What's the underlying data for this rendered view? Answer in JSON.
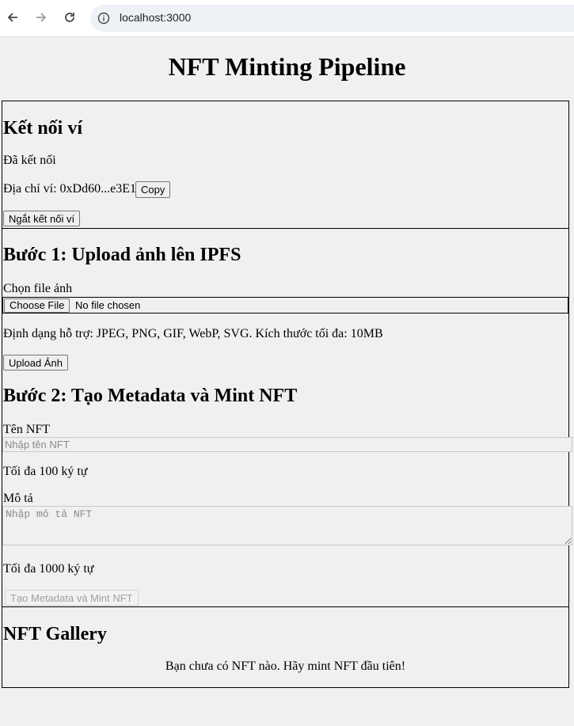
{
  "browser": {
    "url": "localhost:3000"
  },
  "page": {
    "title": "NFT Minting Pipeline"
  },
  "wallet": {
    "heading": "Kết nối ví",
    "status": "Đã kết nối",
    "address_label": "Địa chỉ ví: 0xDd60...e3E1",
    "copy_label": "Copy",
    "disconnect_label": "Ngắt kết nối ví"
  },
  "step1": {
    "heading": "Bước 1: Upload ảnh lên IPFS",
    "file_label": "Chọn file ảnh",
    "choose_file_label": "Choose File",
    "no_file_text": "No file chosen",
    "hint": "Định dạng hỗ trợ: JPEG, PNG, GIF, WebP, SVG. Kích thước tối đa: 10MB",
    "upload_label": "Upload Ảnh"
  },
  "step2": {
    "heading": "Bước 2: Tạo Metadata và Mint NFT",
    "name_label": "Tên NFT",
    "name_placeholder": "Nhập tên NFT",
    "name_hint": "Tối đa 100 ký tự",
    "desc_label": "Mô tả",
    "desc_placeholder": "Nhập mô tả NFT",
    "desc_hint": "Tối đa 1000 ký tự",
    "mint_label": "Tạo Metadata và Mint NFT"
  },
  "gallery": {
    "heading": "NFT Gallery",
    "empty_text": "Bạn chưa có NFT nào. Hãy mint NFT đầu tiên!"
  }
}
